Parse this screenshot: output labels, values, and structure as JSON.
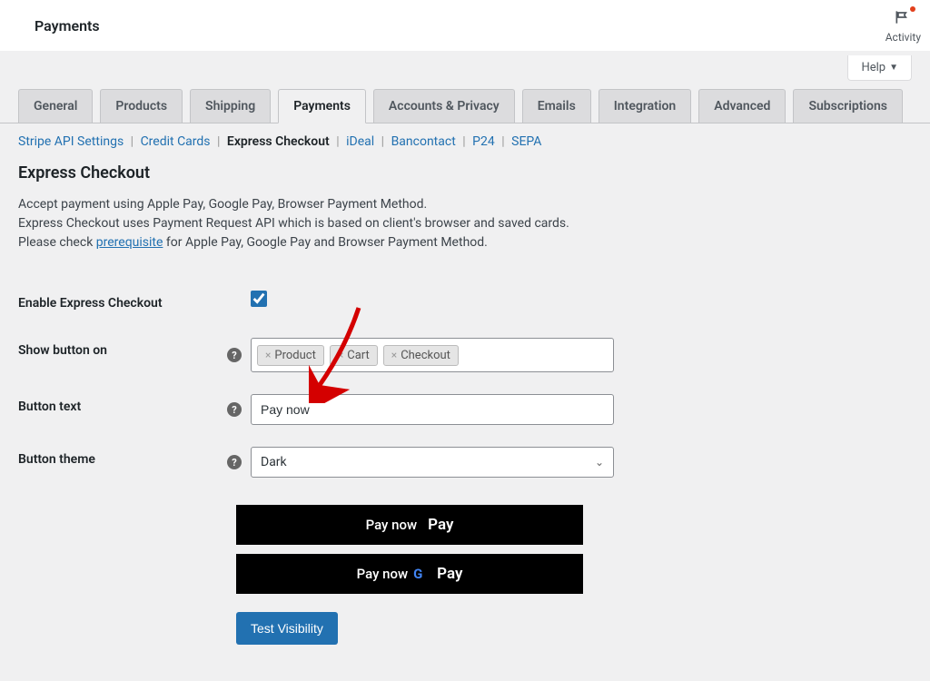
{
  "header": {
    "title": "Payments",
    "activity_label": "Activity"
  },
  "help_label": "Help",
  "tabs": [
    "General",
    "Products",
    "Shipping",
    "Payments",
    "Accounts & Privacy",
    "Emails",
    "Integration",
    "Advanced",
    "Subscriptions"
  ],
  "active_tab": "Payments",
  "subnav": {
    "items": [
      "Stripe API Settings",
      "Credit Cards",
      "Express Checkout",
      "iDeal",
      "Bancontact",
      "P24",
      "SEPA"
    ],
    "current": "Express Checkout"
  },
  "section": {
    "heading": "Express Checkout",
    "desc_line1": "Accept payment using Apple Pay, Google Pay, Browser Payment Method.",
    "desc_line2": "Express Checkout uses Payment Request API which is based on client's browser and saved cards.",
    "desc_line3_pre": "Please check ",
    "desc_line3_link": "prerequisite",
    "desc_line3_post": " for Apple Pay, Google Pay and Browser Payment Method."
  },
  "fields": {
    "enable": {
      "label": "Enable Express Checkout",
      "checked": true
    },
    "show_on": {
      "label": "Show button on",
      "tags": [
        "Product",
        "Cart",
        "Checkout"
      ]
    },
    "button_text": {
      "label": "Button text",
      "value": "Pay now"
    },
    "button_theme": {
      "label": "Button theme",
      "value": "Dark"
    }
  },
  "preview": {
    "apple_text": "Pay now",
    "apple_brand": "Pay",
    "google_text": "Pay now",
    "google_brand": "Pay"
  },
  "test_button": "Test Visibility"
}
